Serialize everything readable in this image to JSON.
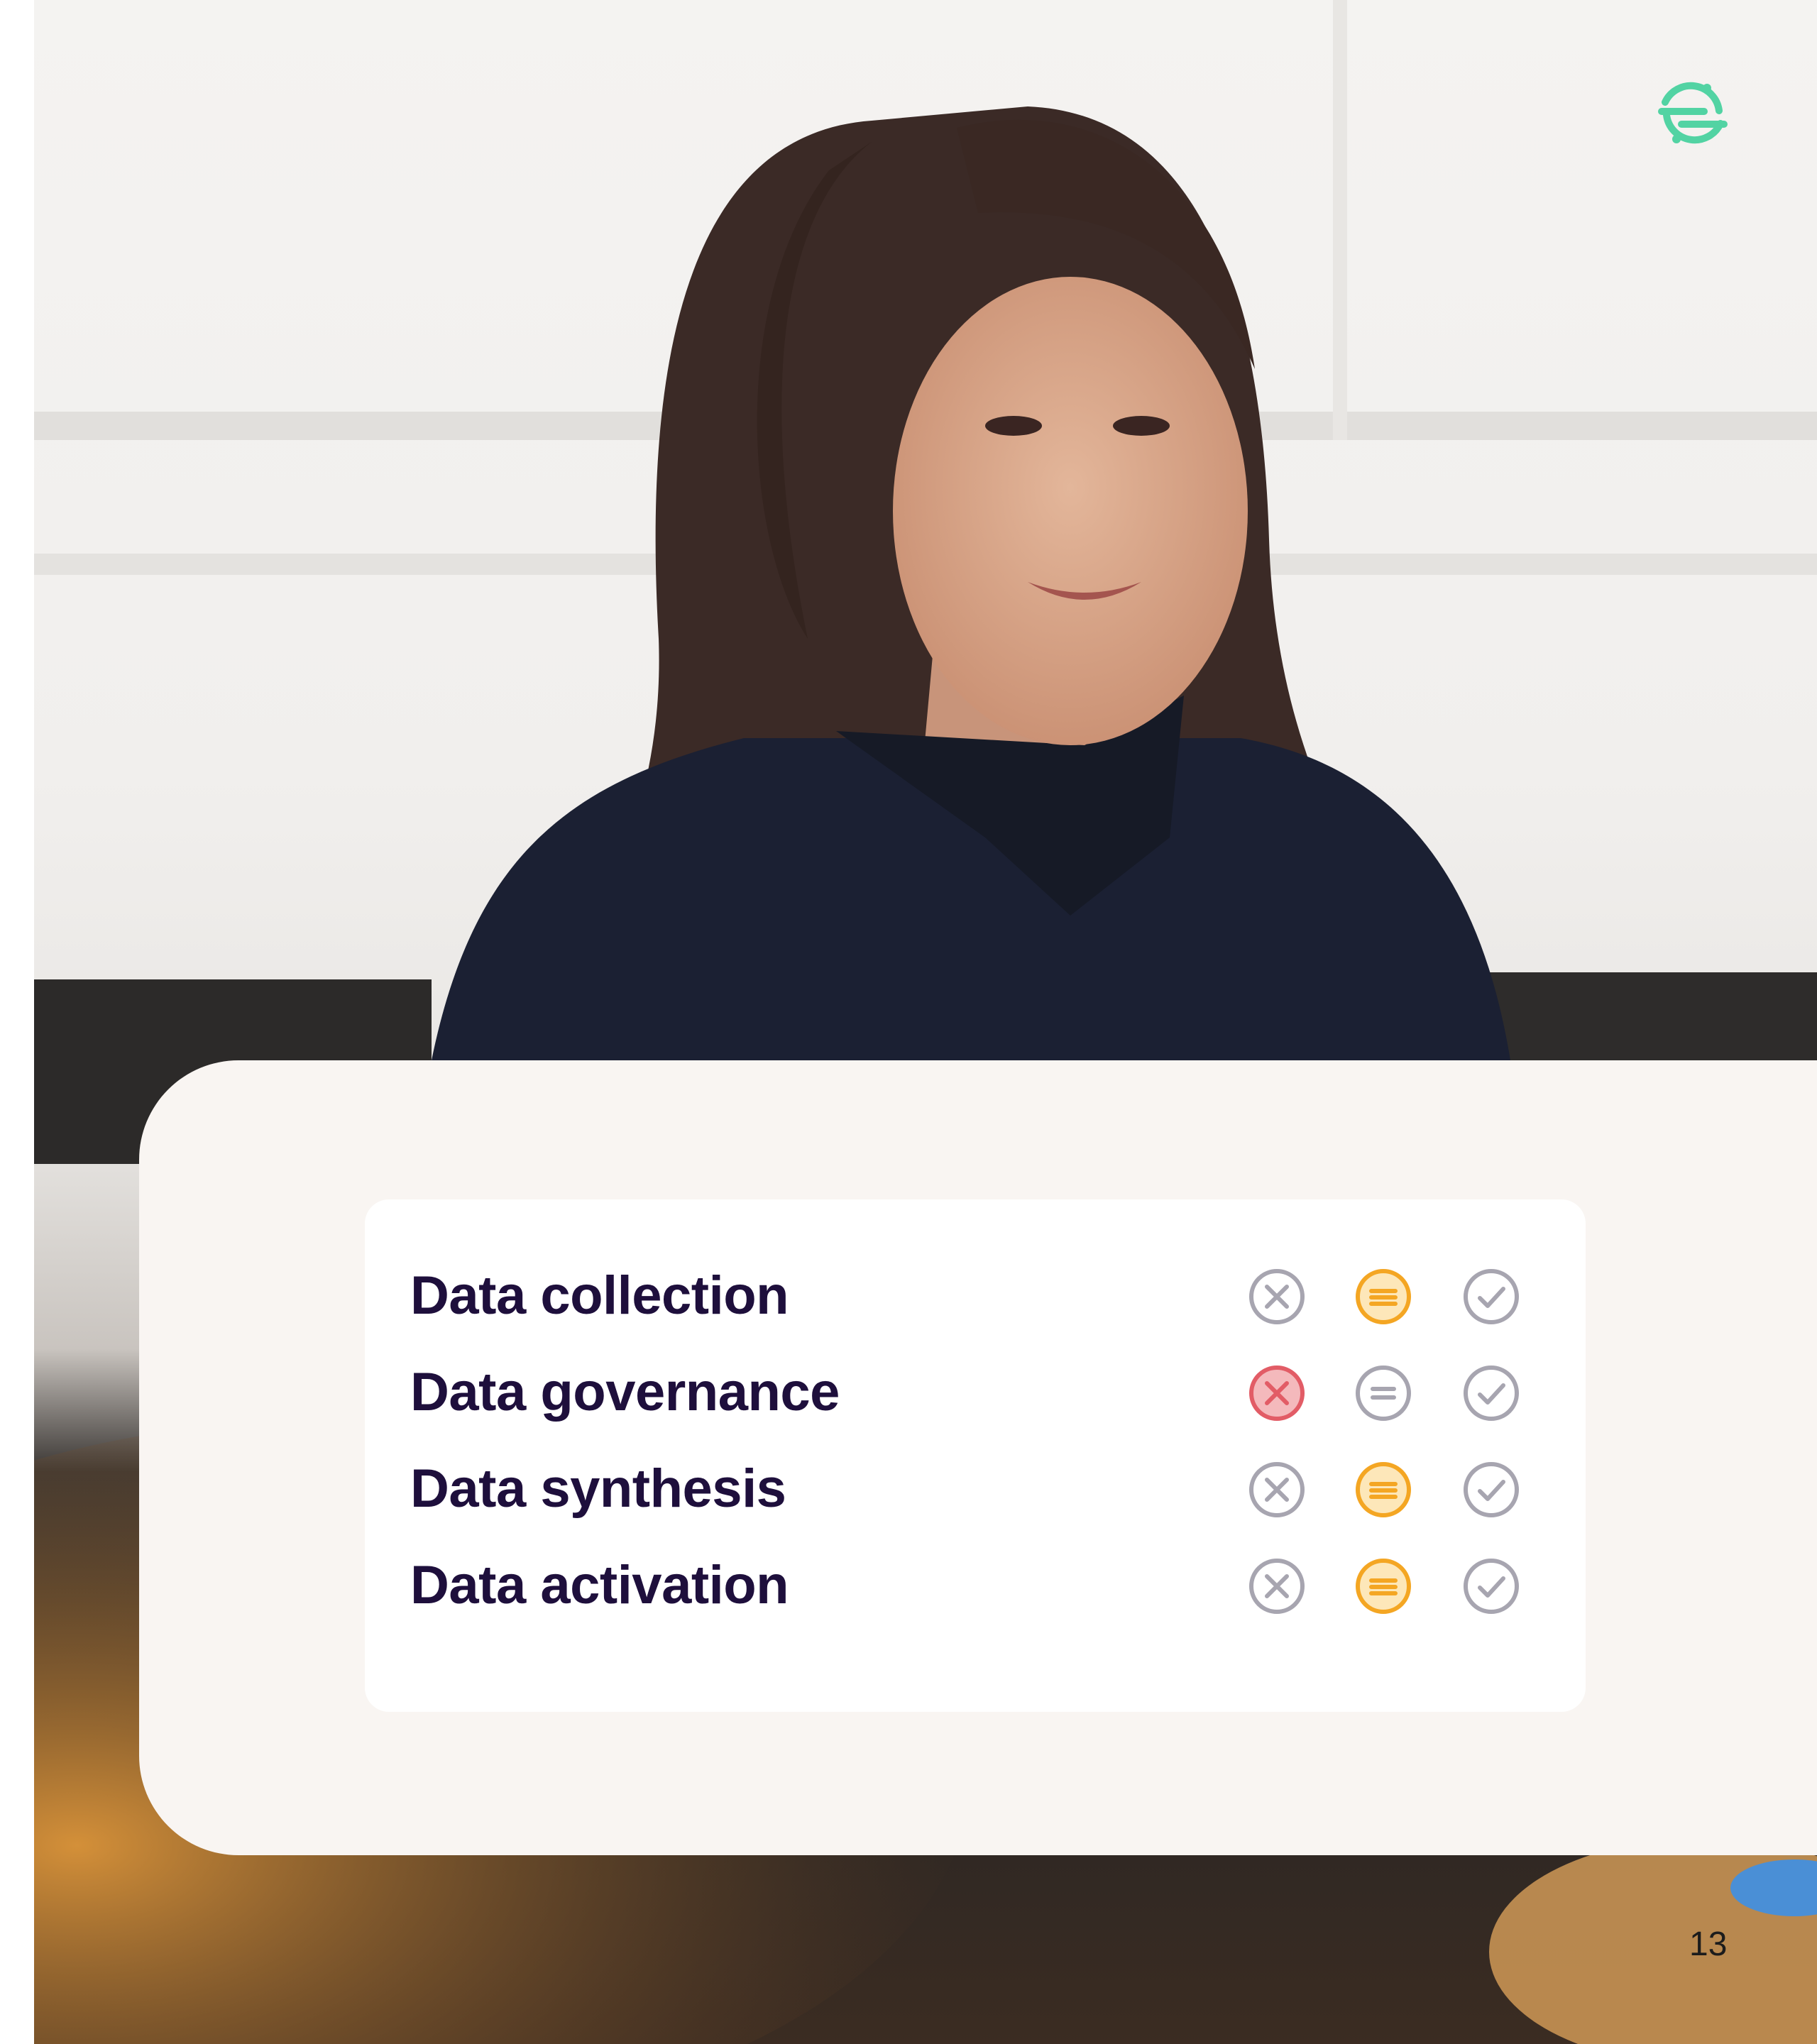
{
  "brand": {
    "logo_icon": "segment-logo-icon",
    "accent": "#52d3a3"
  },
  "photo": {
    "icon": "photo-woman-portrait"
  },
  "card": {
    "rows": [
      {
        "label": "Data collection",
        "statuses": [
          "x-circle-icon",
          "equals-circle-icon",
          "check-circle-icon"
        ],
        "active": [
          false,
          true,
          false
        ]
      },
      {
        "label": "Data governance",
        "statuses": [
          "x-circle-icon",
          "equals-circle-icon",
          "check-circle-icon"
        ],
        "active": [
          true,
          false,
          false
        ]
      },
      {
        "label": "Data synthesis",
        "statuses": [
          "x-circle-icon",
          "equals-circle-icon",
          "check-circle-icon"
        ],
        "active": [
          false,
          true,
          false
        ]
      },
      {
        "label": "Data activation",
        "statuses": [
          "x-circle-icon",
          "equals-circle-icon",
          "check-circle-icon"
        ],
        "active": [
          false,
          true,
          false
        ]
      }
    ]
  },
  "colors": {
    "inactive": "#a7a5b0",
    "warning": "#f4a623",
    "danger": "#e25c66",
    "text": "#1e0f3c",
    "card_bg": "#f9f5f2"
  },
  "page_number": "13"
}
